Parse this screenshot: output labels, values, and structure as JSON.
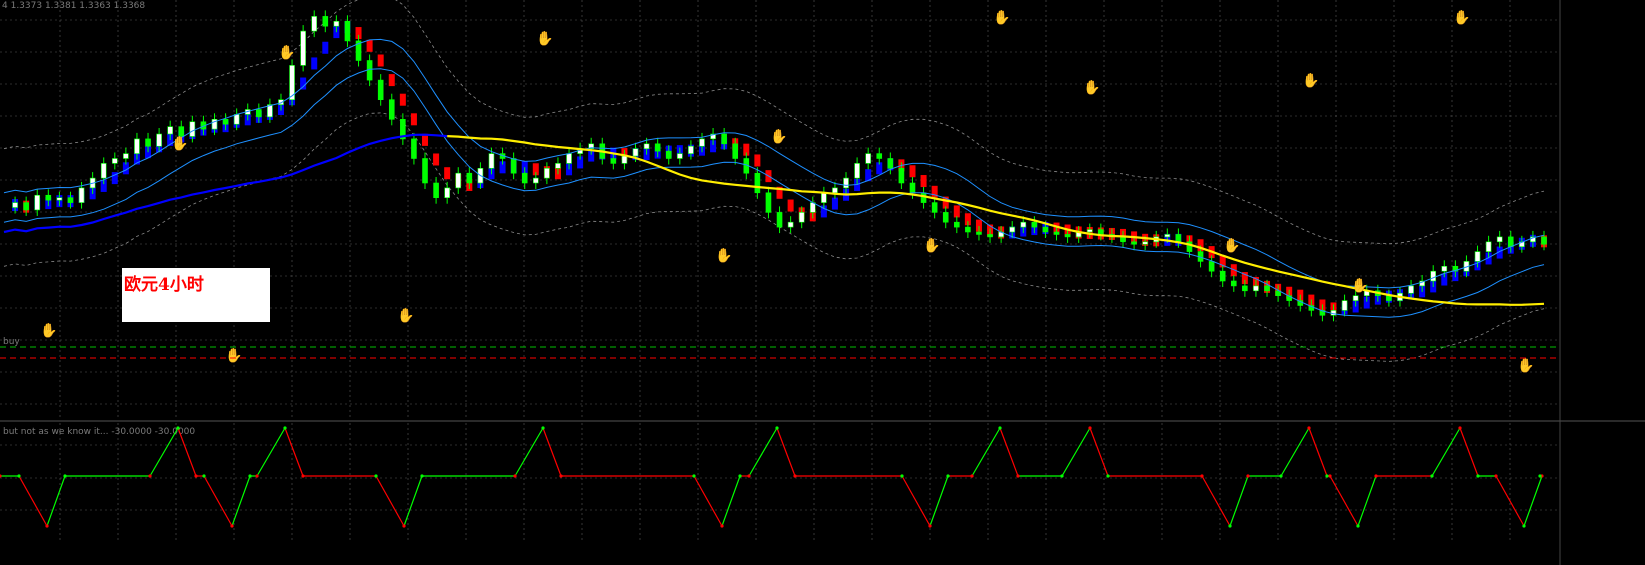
{
  "header": {
    "ohlc_text": "4  1.3373 1.3381 1.3363 1.3368",
    "overlay_label": "欧元4小时"
  },
  "lines": {
    "buy_label": "buy",
    "buy_level_color": "#00c000",
    "sell_level_color": "#ff0000"
  },
  "subwindow": {
    "title": "but not as we know it... -30.0000 -30.0000"
  },
  "colors": {
    "background": "#000000",
    "grid": "#5a5a5a",
    "bull_candle": "#ffffff",
    "bear_candle": "#00ff00",
    "trend_up": "#0000ff",
    "trend_down": "#ff0000",
    "ma_slow": "#ffee00",
    "ma_mid": "#1e90ff",
    "ma_fast": "#1e90ff",
    "band": "#8a8a8a",
    "osc_up": "#00ff00",
    "osc_down": "#ff0000"
  },
  "chart_data": {
    "type": "candlestick",
    "series_count": 160,
    "candles": [
      [
        0,
        20
      ],
      [
        1,
        22
      ],
      [
        2,
        19
      ],
      [
        3,
        25
      ],
      [
        4,
        23
      ],
      [
        5,
        24
      ],
      [
        6,
        22
      ],
      [
        7,
        28
      ],
      [
        8,
        32
      ],
      [
        9,
        38
      ],
      [
        10,
        40
      ],
      [
        11,
        42
      ],
      [
        12,
        48
      ],
      [
        13,
        45
      ],
      [
        14,
        50
      ],
      [
        15,
        53
      ],
      [
        16,
        49
      ],
      [
        17,
        55
      ],
      [
        18,
        52
      ],
      [
        19,
        56
      ],
      [
        20,
        54
      ],
      [
        21,
        58
      ],
      [
        22,
        60
      ],
      [
        23,
        57
      ],
      [
        24,
        62
      ],
      [
        25,
        64
      ],
      [
        26,
        78
      ],
      [
        27,
        92
      ],
      [
        28,
        98
      ],
      [
        29,
        94
      ],
      [
        30,
        96
      ],
      [
        31,
        88
      ],
      [
        32,
        80
      ],
      [
        33,
        72
      ],
      [
        34,
        64
      ],
      [
        35,
        56
      ],
      [
        36,
        48
      ],
      [
        37,
        40
      ],
      [
        38,
        30
      ],
      [
        39,
        24
      ],
      [
        40,
        28
      ],
      [
        41,
        34
      ],
      [
        42,
        30
      ],
      [
        43,
        36
      ],
      [
        44,
        42
      ],
      [
        45,
        40
      ],
      [
        46,
        34
      ],
      [
        47,
        30
      ],
      [
        48,
        32
      ],
      [
        49,
        36
      ],
      [
        50,
        38
      ],
      [
        51,
        42
      ],
      [
        52,
        44
      ],
      [
        53,
        46
      ],
      [
        54,
        40
      ],
      [
        55,
        38
      ],
      [
        56,
        41
      ],
      [
        57,
        44
      ],
      [
        58,
        46
      ],
      [
        59,
        43
      ],
      [
        60,
        40
      ],
      [
        61,
        42
      ],
      [
        62,
        45
      ],
      [
        63,
        48
      ],
      [
        64,
        50
      ],
      [
        65,
        46
      ],
      [
        66,
        40
      ],
      [
        67,
        34
      ],
      [
        68,
        26
      ],
      [
        69,
        18
      ],
      [
        70,
        12
      ],
      [
        71,
        14
      ],
      [
        72,
        18
      ],
      [
        73,
        22
      ],
      [
        74,
        26
      ],
      [
        75,
        28
      ],
      [
        76,
        32
      ],
      [
        77,
        38
      ],
      [
        78,
        42
      ],
      [
        79,
        40
      ],
      [
        80,
        36
      ],
      [
        81,
        30
      ],
      [
        82,
        26
      ],
      [
        83,
        22
      ],
      [
        84,
        18
      ],
      [
        85,
        14
      ],
      [
        86,
        12
      ],
      [
        87,
        10
      ],
      [
        88,
        9
      ],
      [
        89,
        8
      ],
      [
        90,
        10
      ],
      [
        91,
        12
      ],
      [
        92,
        14
      ],
      [
        93,
        12
      ],
      [
        94,
        10
      ],
      [
        95,
        9
      ],
      [
        96,
        8
      ],
      [
        97,
        10
      ],
      [
        98,
        11
      ],
      [
        99,
        9
      ],
      [
        100,
        8
      ],
      [
        101,
        6
      ],
      [
        102,
        5
      ],
      [
        103,
        6
      ],
      [
        104,
        8
      ],
      [
        105,
        9
      ],
      [
        106,
        6
      ],
      [
        107,
        2
      ],
      [
        108,
        -2
      ],
      [
        109,
        -6
      ],
      [
        110,
        -10
      ],
      [
        111,
        -12
      ],
      [
        112,
        -14
      ],
      [
        113,
        -12
      ],
      [
        114,
        -14
      ],
      [
        115,
        -16
      ],
      [
        116,
        -18
      ],
      [
        117,
        -20
      ],
      [
        118,
        -22
      ],
      [
        119,
        -24
      ],
      [
        120,
        -22
      ],
      [
        121,
        -18
      ],
      [
        122,
        -16
      ],
      [
        123,
        -14
      ],
      [
        124,
        -16
      ],
      [
        125,
        -18
      ],
      [
        126,
        -15
      ],
      [
        127,
        -12
      ],
      [
        128,
        -10
      ],
      [
        129,
        -6
      ],
      [
        130,
        -4
      ],
      [
        131,
        -6
      ],
      [
        132,
        -2
      ],
      [
        133,
        2
      ],
      [
        134,
        6
      ],
      [
        135,
        8
      ],
      [
        136,
        4
      ],
      [
        137,
        6
      ],
      [
        138,
        8
      ],
      [
        139,
        5
      ]
    ],
    "oscillator": {
      "peaks_x": [
        178,
        285,
        543,
        777,
        1000,
        1090,
        1309,
        1460
      ],
      "troughs_x": [
        47,
        232,
        404,
        722,
        930,
        1230,
        1358,
        1524
      ],
      "ymin": -100,
      "ymax": 100
    }
  }
}
